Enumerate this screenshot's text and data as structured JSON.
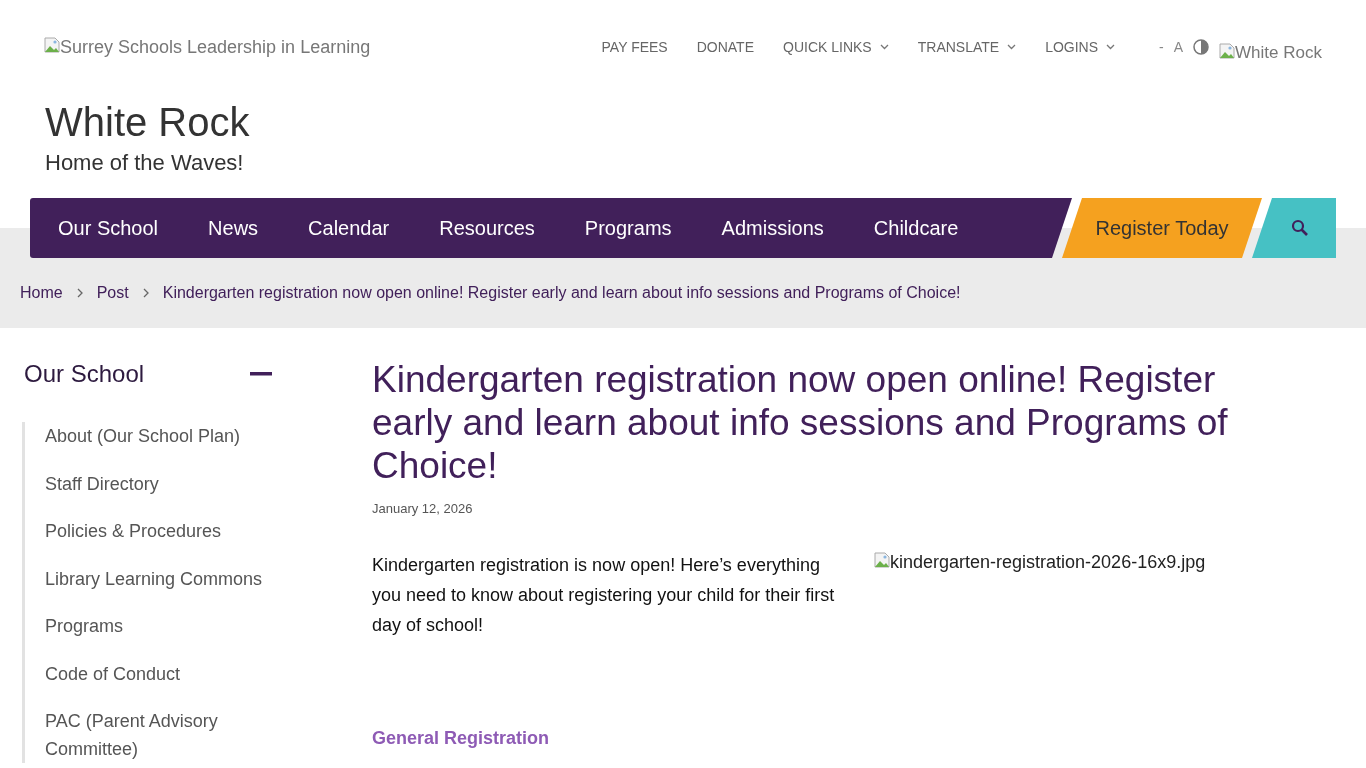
{
  "logo": {
    "alt_text": "Surrey Schools Leadership in Learning"
  },
  "utility_links": [
    {
      "label": "PAY FEES",
      "dropdown": false
    },
    {
      "label": "DONATE",
      "dropdown": false
    },
    {
      "label": "QUICK LINKS",
      "dropdown": true
    },
    {
      "label": "TRANSLATE",
      "dropdown": true
    },
    {
      "label": "LOGINS",
      "dropdown": true
    }
  ],
  "accessibility_tools": {
    "decrease_text": "-",
    "text_size": "A",
    "school_image_alt": "White Rock"
  },
  "school": {
    "name": "White Rock",
    "tagline": "Home of the Waves!"
  },
  "main_nav": [
    "Our School",
    "News",
    "Calendar",
    "Resources",
    "Programs",
    "Admissions",
    "Childcare"
  ],
  "register_button": "Register Today",
  "breadcrumbs": [
    "Home",
    "Post",
    "Kindergarten registration now open online! Register early and learn about info sessions and Programs of Choice!"
  ],
  "sidebar": {
    "title": "Our School",
    "expanded": true,
    "items": [
      "About (Our School Plan)",
      "Staff Directory",
      "Policies & Procedures",
      "Library Learning Commons",
      "Programs",
      "Code of Conduct",
      "PAC (Parent Advisory Committee)"
    ]
  },
  "article": {
    "title": "Kindergarten registration now open online! Register early and learn about info sessions and Programs of Choice!",
    "date": "January 12, 2026",
    "intro": "Kindergarten registration is now open! Here’s everything you need to know about registering your child for their first day of school!",
    "image_alt": "kindergarten-registration-2026-16x9.jpg",
    "section_heading": "General Registration"
  }
}
